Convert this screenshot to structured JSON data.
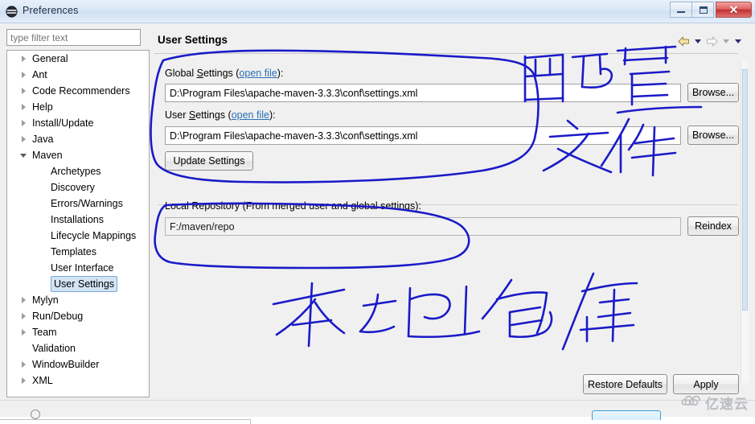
{
  "window": {
    "title": "Preferences",
    "icon": "preferences-icon",
    "controls": {
      "minimize": "minimize-icon",
      "maximize": "restore-icon",
      "close": "✕"
    }
  },
  "sidebar": {
    "filter_placeholder": "type filter text",
    "filter_value": "",
    "items": [
      {
        "label": "General",
        "level": 1,
        "expandable": true,
        "expanded": false,
        "selected": false
      },
      {
        "label": "Ant",
        "level": 1,
        "expandable": true,
        "expanded": false,
        "selected": false
      },
      {
        "label": "Code Recommenders",
        "level": 1,
        "expandable": true,
        "expanded": false,
        "selected": false
      },
      {
        "label": "Help",
        "level": 1,
        "expandable": true,
        "expanded": false,
        "selected": false
      },
      {
        "label": "Install/Update",
        "level": 1,
        "expandable": true,
        "expanded": false,
        "selected": false
      },
      {
        "label": "Java",
        "level": 1,
        "expandable": true,
        "expanded": false,
        "selected": false
      },
      {
        "label": "Maven",
        "level": 1,
        "expandable": true,
        "expanded": true,
        "selected": false
      },
      {
        "label": "Archetypes",
        "level": 2,
        "expandable": false,
        "expanded": false,
        "selected": false
      },
      {
        "label": "Discovery",
        "level": 2,
        "expandable": false,
        "expanded": false,
        "selected": false
      },
      {
        "label": "Errors/Warnings",
        "level": 2,
        "expandable": false,
        "expanded": false,
        "selected": false
      },
      {
        "label": "Installations",
        "level": 2,
        "expandable": false,
        "expanded": false,
        "selected": false
      },
      {
        "label": "Lifecycle Mappings",
        "level": 2,
        "expandable": false,
        "expanded": false,
        "selected": false
      },
      {
        "label": "Templates",
        "level": 2,
        "expandable": false,
        "expanded": false,
        "selected": false
      },
      {
        "label": "User Interface",
        "level": 2,
        "expandable": false,
        "expanded": false,
        "selected": false
      },
      {
        "label": "User Settings",
        "level": 2,
        "expandable": false,
        "expanded": false,
        "selected": true
      },
      {
        "label": "Mylyn",
        "level": 1,
        "expandable": true,
        "expanded": false,
        "selected": false
      },
      {
        "label": "Run/Debug",
        "level": 1,
        "expandable": true,
        "expanded": false,
        "selected": false
      },
      {
        "label": "Team",
        "level": 1,
        "expandable": true,
        "expanded": false,
        "selected": false
      },
      {
        "label": "Validation",
        "level": 1,
        "expandable": false,
        "expanded": false,
        "selected": false
      },
      {
        "label": "WindowBuilder",
        "level": 1,
        "expandable": true,
        "expanded": false,
        "selected": false
      },
      {
        "label": "XML",
        "level": 1,
        "expandable": true,
        "expanded": false,
        "selected": false
      }
    ]
  },
  "page": {
    "title": "User Settings",
    "nav": {
      "back": "back-arrow-icon",
      "back_menu": "chevron-down-icon",
      "forward": "forward-arrow-icon",
      "forward_menu": "chevron-down-icon",
      "view_menu": "chevron-down-icon"
    },
    "global_settings": {
      "label_prefix": "Global ",
      "label_mnemonic": "S",
      "label_suffix": "ettings (",
      "link": "open file",
      "label_end": "):",
      "value": "D:\\Program Files\\apache-maven-3.3.3\\conf\\settings.xml",
      "browse_label": "Browse..."
    },
    "user_settings": {
      "label_prefix": "User ",
      "label_mnemonic": "S",
      "label_suffix": "ettings (",
      "link": "open file",
      "label_end": "):",
      "value": "D:\\Program Files\\apache-maven-3.3.3\\conf\\settings.xml",
      "browse_label": "Browse..."
    },
    "update_settings_label": "Update Settings",
    "local_repository": {
      "label": "Local Repository (From merged user and global settings):",
      "value": "F:/maven/repo",
      "reindex_label": "Reindex"
    },
    "restore_defaults_label": "Restore Defaults",
    "apply_label": "Apply"
  },
  "annotations": {
    "ink_color": "#1a1ac8",
    "top_text": "配置文件",
    "bottom_text": "本地包库"
  },
  "watermark": {
    "text": "亿速云",
    "icon": "cloud-logo-icon",
    "color": "#b9bdc2"
  }
}
